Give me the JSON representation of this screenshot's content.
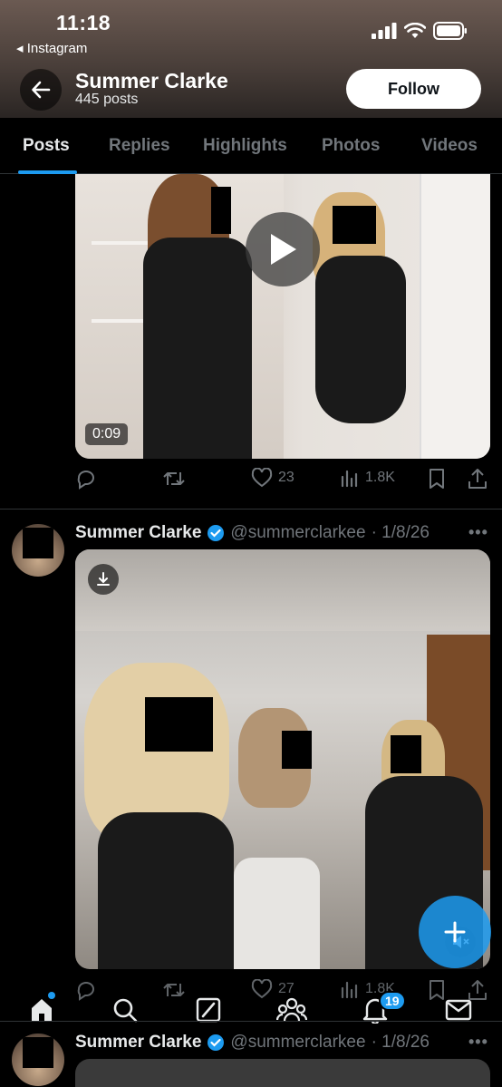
{
  "status_bar": {
    "time": "11:18",
    "back_app": "◂ Instagram"
  },
  "profile": {
    "name": "Summer Clarke",
    "post_count": "445 posts",
    "follow_label": "Follow"
  },
  "tabs": [
    {
      "label": "Posts",
      "active": true
    },
    {
      "label": "Replies",
      "active": false
    },
    {
      "label": "Highlights",
      "active": false
    },
    {
      "label": "Photos",
      "active": false
    },
    {
      "label": "Videos",
      "active": false
    }
  ],
  "posts": [
    {
      "video_duration": "0:09",
      "likes": "23",
      "views": "1.8K"
    },
    {
      "author": "Summer Clarke",
      "handle": "@summerclarkee",
      "date": "· 1/8/26",
      "likes": "27",
      "views": "1.8K"
    },
    {
      "author": "Summer Clarke",
      "handle": "@summerclarkee",
      "date": "· 1/8/26"
    }
  ],
  "nav": {
    "notifications_badge": "19"
  },
  "colors": {
    "accent": "#1d9bf0",
    "muted": "#71767b",
    "verified": "#1d9bf0"
  },
  "icons": [
    "back-arrow-icon",
    "play-icon",
    "reply-icon",
    "retweet-icon",
    "heart-icon",
    "views-icon",
    "bookmark-icon",
    "share-icon",
    "verified-icon",
    "more-icon",
    "download-icon",
    "mute-icon",
    "compose-icon",
    "home-icon",
    "search-icon",
    "grok-icon",
    "communities-icon",
    "bell-icon",
    "mail-icon"
  ]
}
